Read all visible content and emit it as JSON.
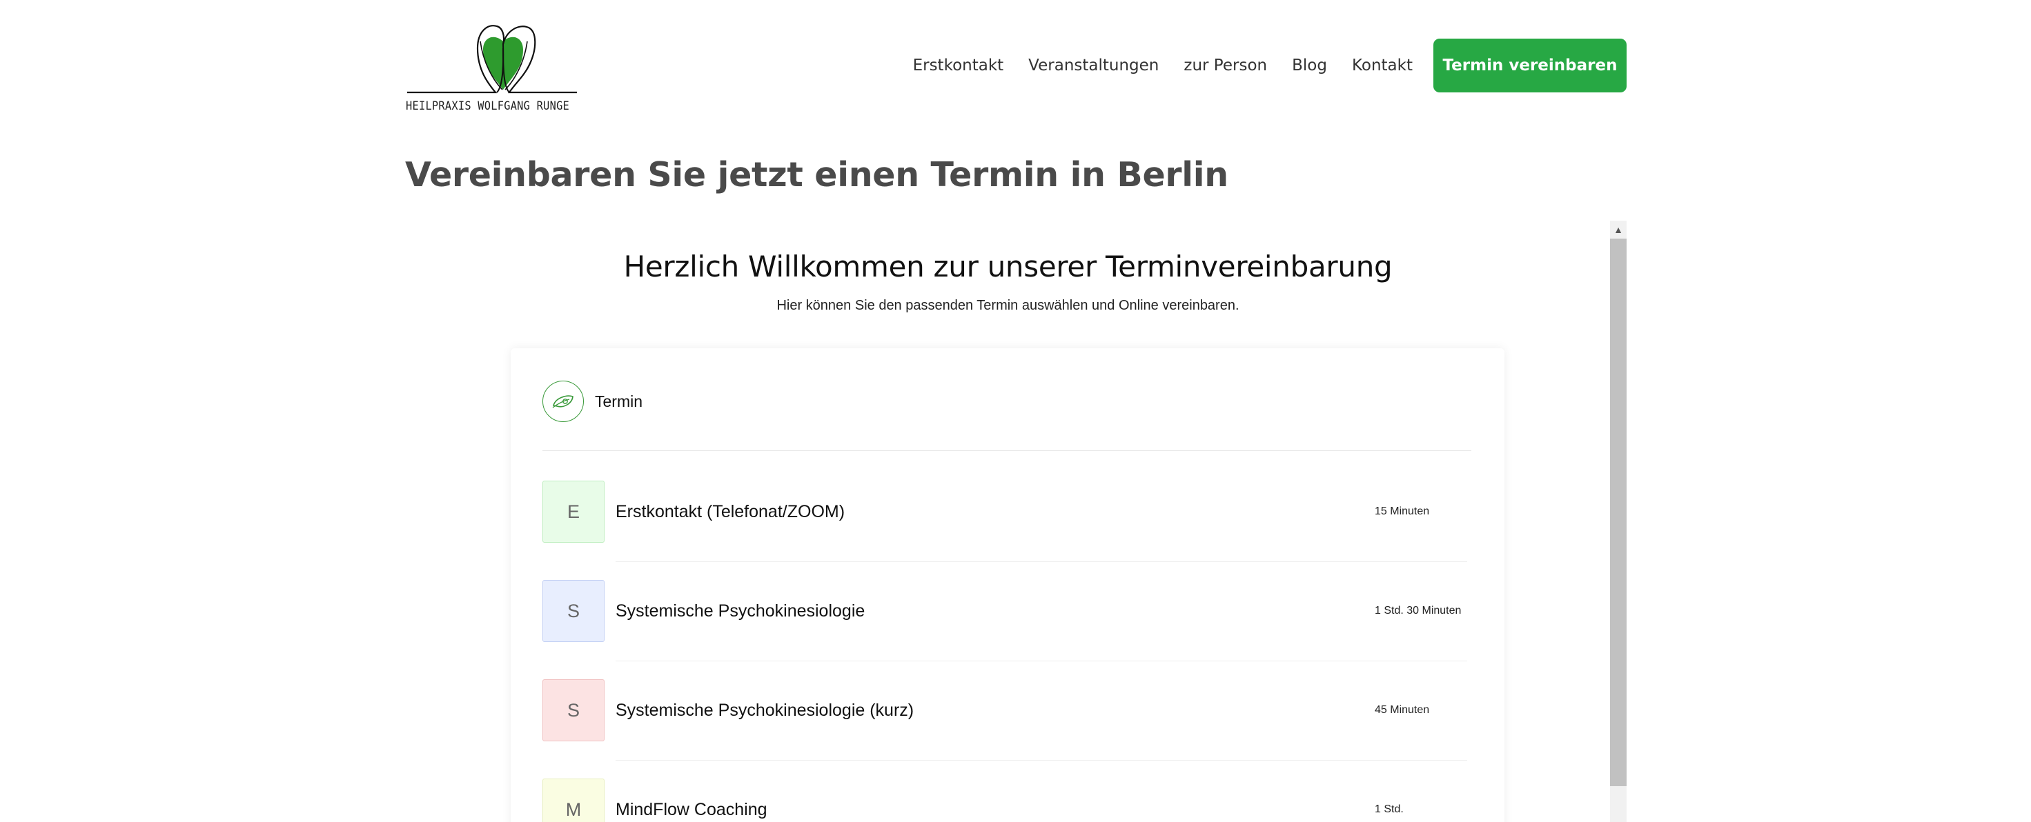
{
  "header": {
    "logo_text": "HEILPRAXIS WOLFGANG RUNGE",
    "nav": [
      "Erstkontakt",
      "Veranstaltungen",
      "zur Person",
      "Blog",
      "Kontakt"
    ],
    "cta_label": "Termin vereinbaren"
  },
  "page": {
    "title": "Vereinbaren Sie jetzt einen Termin in Berlin"
  },
  "booking": {
    "title": "Herzlich Willkommen zur unserer Terminvereinbarung",
    "subtitle": "Hier können Sie den passenden Termin auswählen und Online vereinbaren.",
    "category_label": "Termin",
    "services": [
      {
        "letter": "E",
        "name": "Erstkontakt (Telefonat/ZOOM)",
        "duration": "15 Minuten",
        "bg": "#e8fce8",
        "border": "#bfeec0"
      },
      {
        "letter": "S",
        "name": "Systemische Psychokinesiologie",
        "duration": "1 Std. 30 Minuten",
        "bg": "#e8eefe",
        "border": "#c3d0f4"
      },
      {
        "letter": "S",
        "name": "Systemische Psychokinesiologie (kurz)",
        "duration": "45 Minuten",
        "bg": "#fce3e3",
        "border": "#f1c2c2"
      },
      {
        "letter": "M",
        "name": "MindFlow Coaching",
        "duration": "1 Std.",
        "bg": "#fafde2",
        "border": "#e8efbf"
      }
    ]
  },
  "colors": {
    "brand_green": "#27a844",
    "logo_green": "#2e9b2e",
    "title_gray": "#4a4a4a"
  }
}
